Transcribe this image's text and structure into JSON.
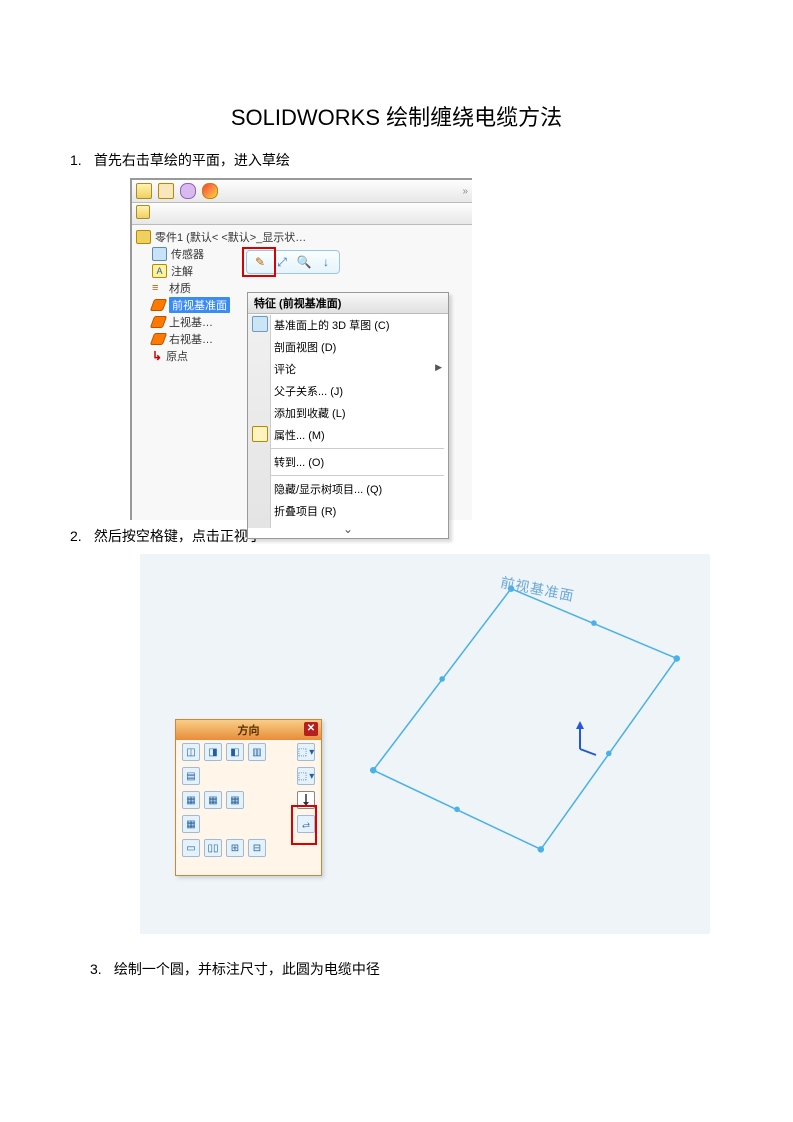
{
  "title": "SOLIDWORKS  绘制缠绕电缆方法",
  "step1": "首先右击草绘的平面，进入草绘",
  "step2": "然后按空格键，点击正视于",
  "step3": "绘制一个圆，并标注尺寸，此圆为电缆中径",
  "num1": "1.",
  "num2": "2.",
  "num3": "3.",
  "tree": {
    "part": "零件1  (默认< <默认>_显示状…",
    "sensors": "传感器",
    "annotations": "注解",
    "material": "材质",
    "frontPlane": "前视基准面",
    "topPlane": "上视基",
    "rightPlane": "右视基",
    "origin": "原点"
  },
  "contextMenu": {
    "title": "特征  (前视基准面)",
    "sketch3d": "基准面上的 3D 草图 (C)",
    "sectionView": "剖面视图  (D)",
    "comment": "评论",
    "parentChild": "父子关系... (J)",
    "addFav": "添加到收藏 (L)",
    "properties": "属性... (M)",
    "goto": "转到... (O)",
    "hideShow": "隐藏/显示树项目... (Q)",
    "collapse": "折叠项目 (R)"
  },
  "orientation": {
    "title": "方向",
    "planeLabel": "前视基准面"
  }
}
